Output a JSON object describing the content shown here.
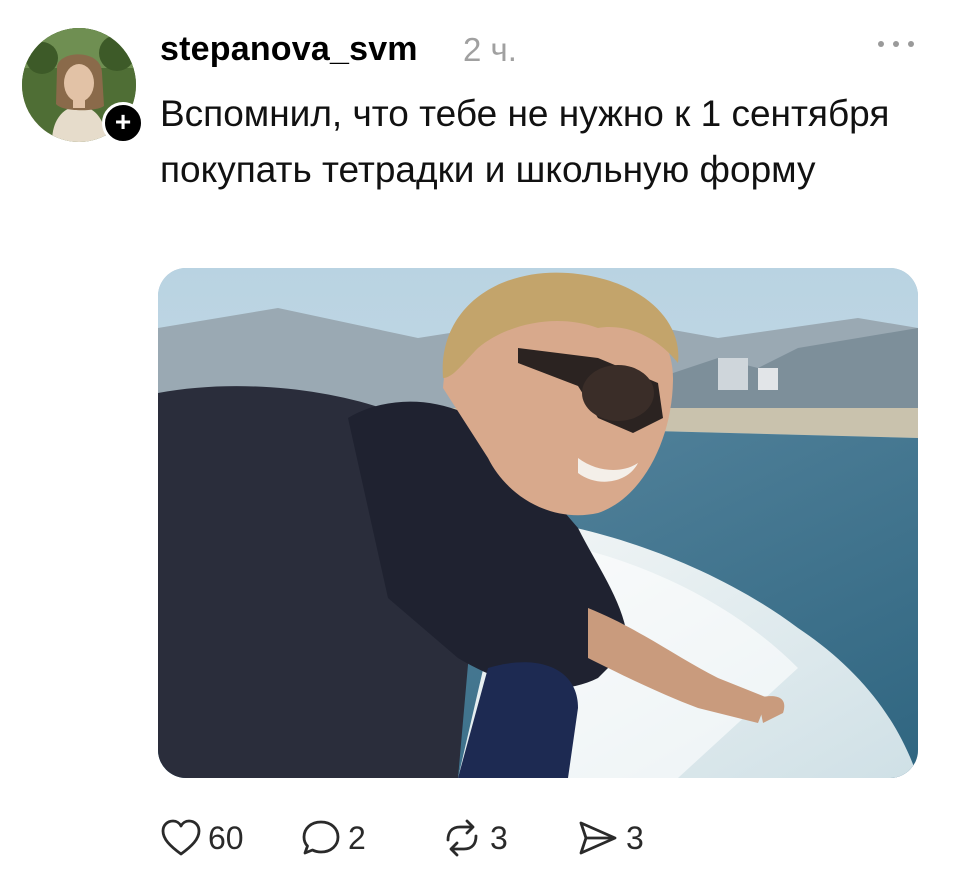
{
  "post": {
    "username": "stepanova_svm",
    "time": "2 ч.",
    "text": "Вспомнил, что тебе не нужно к 1 сентября покупать тетрадки и школьную форму",
    "follow_label": "+",
    "image_icon": "photo-man-on-boat",
    "actions": {
      "likes": "60",
      "comments": "2",
      "reposts": "3",
      "shares": "3"
    }
  },
  "icons": {
    "more": "more-dots-icon",
    "like": "heart-icon",
    "comment": "comment-bubble-icon",
    "repost": "repost-icon",
    "share": "send-icon"
  },
  "colors": {
    "text": "#111111",
    "muted": "#a0a0a0",
    "badge": "#000000"
  }
}
